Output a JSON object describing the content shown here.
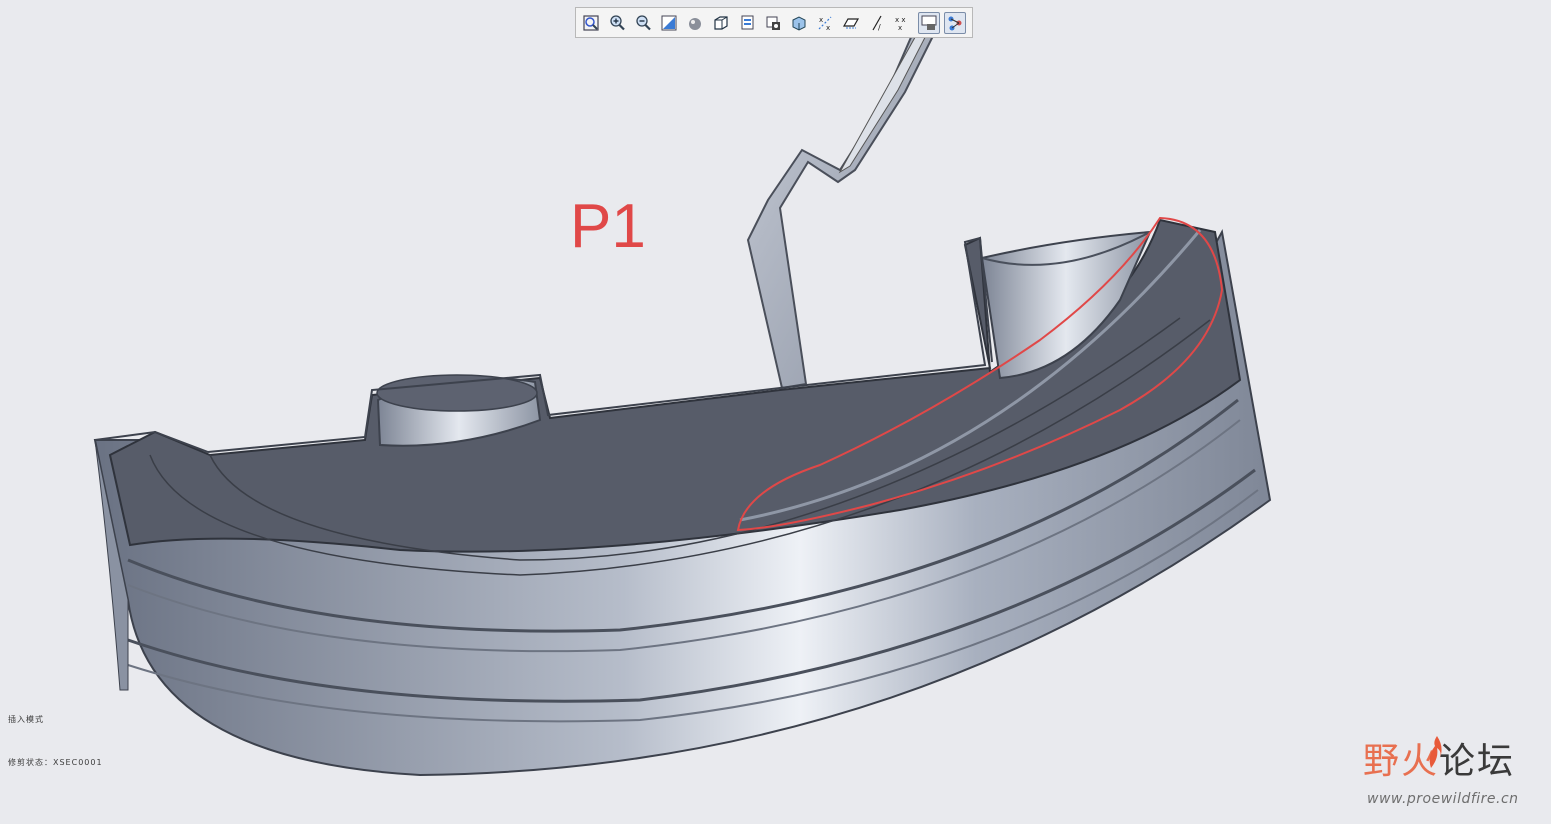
{
  "toolbar": {
    "buttons": [
      {
        "name": "refit-icon",
        "label": "Refit"
      },
      {
        "name": "zoom-in-icon",
        "label": "Zoom In"
      },
      {
        "name": "zoom-out-icon",
        "label": "Zoom Out"
      },
      {
        "name": "repaint-icon",
        "label": "Repaint"
      },
      {
        "name": "display-style-icon",
        "label": "Display Style"
      },
      {
        "name": "saved-orientations-icon",
        "label": "Saved Orientations"
      },
      {
        "name": "view-manager-icon",
        "label": "View Manager"
      },
      {
        "name": "perspective-view-icon",
        "label": "Perspective View"
      },
      {
        "name": "section-icon",
        "label": "Section"
      },
      {
        "name": "datum-display-icon",
        "label": "Datum Display Filters"
      },
      {
        "name": "plane-display-icon",
        "label": "Plane Display"
      },
      {
        "name": "axis-display-icon",
        "label": "Axis Display"
      },
      {
        "name": "point-display-icon",
        "label": "Point Display"
      },
      {
        "name": "csys-display-icon",
        "label": "Csys Display"
      },
      {
        "name": "annotation-display-icon",
        "label": "Annotation Display"
      }
    ],
    "active_index": [
      13,
      14
    ]
  },
  "annotation": {
    "label": "P1",
    "color": "#e04848"
  },
  "status": {
    "mode": "插入模式",
    "section_state": "修剪状态：XSEC0001"
  },
  "watermark": {
    "title_part1": "野火",
    "title_part2": "论坛",
    "url": "www.proewildfire.cn"
  },
  "colors": {
    "background": "#e9eaee",
    "part_surface": "#9aa3b3",
    "cut_face": "#575c69",
    "highlight": "#e04848"
  }
}
